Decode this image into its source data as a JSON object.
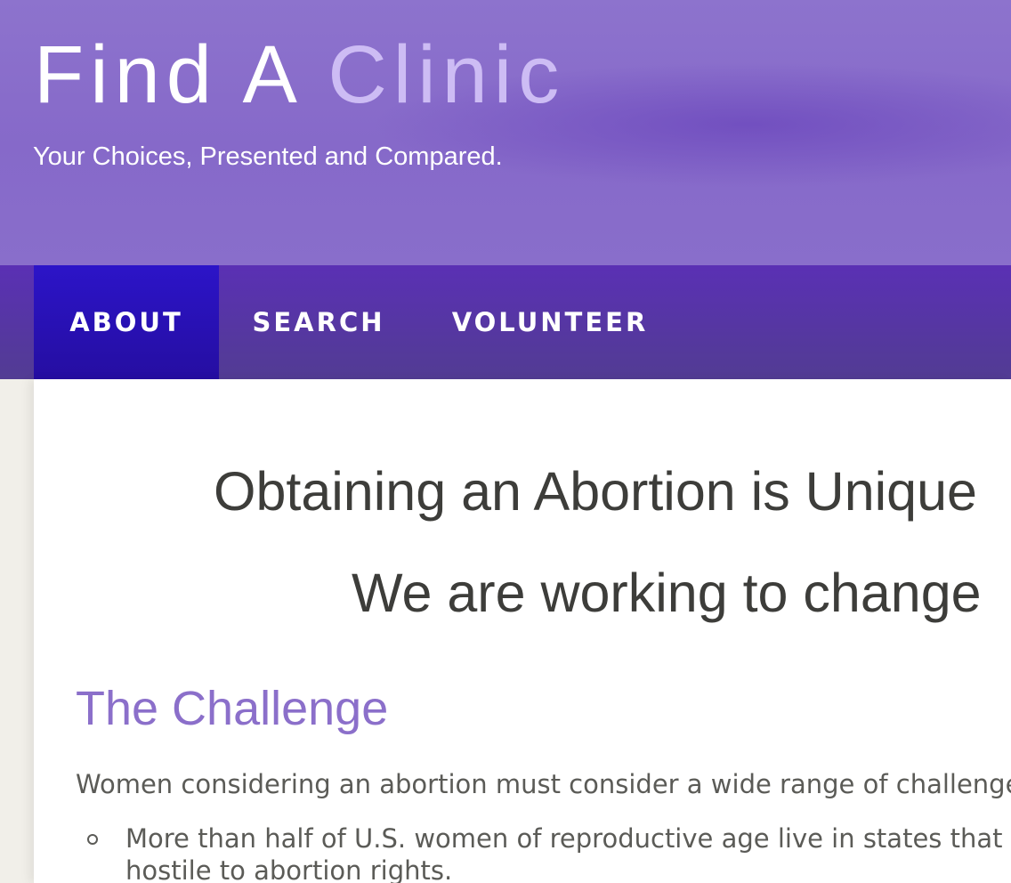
{
  "header": {
    "title_part1": "Find A",
    "title_part2": "Clinic",
    "tagline": "Your Choices, Presented and Compared."
  },
  "nav": {
    "items": [
      {
        "label": "ABOUT",
        "active": true
      },
      {
        "label": "SEARCH",
        "active": false
      },
      {
        "label": "VOLUNTEER",
        "active": false
      }
    ]
  },
  "main": {
    "headline_1": "Obtaining an Abortion is Unique",
    "headline_2": "We are working to change",
    "section_heading": "The Challenge",
    "intro": "Women considering an abortion must consider a wide range of challenges",
    "bullets": [
      "More than half of U.S. women of reproductive age live in states that a hostile to abortion rights."
    ]
  },
  "colors": {
    "header_bg": "#8669c9",
    "title_accent": "#cdbcf4",
    "nav_bg": "#5a30b4",
    "nav_active": "#2c14c8",
    "heading_purple": "#8b6fca",
    "body_text": "#5b5b57"
  }
}
